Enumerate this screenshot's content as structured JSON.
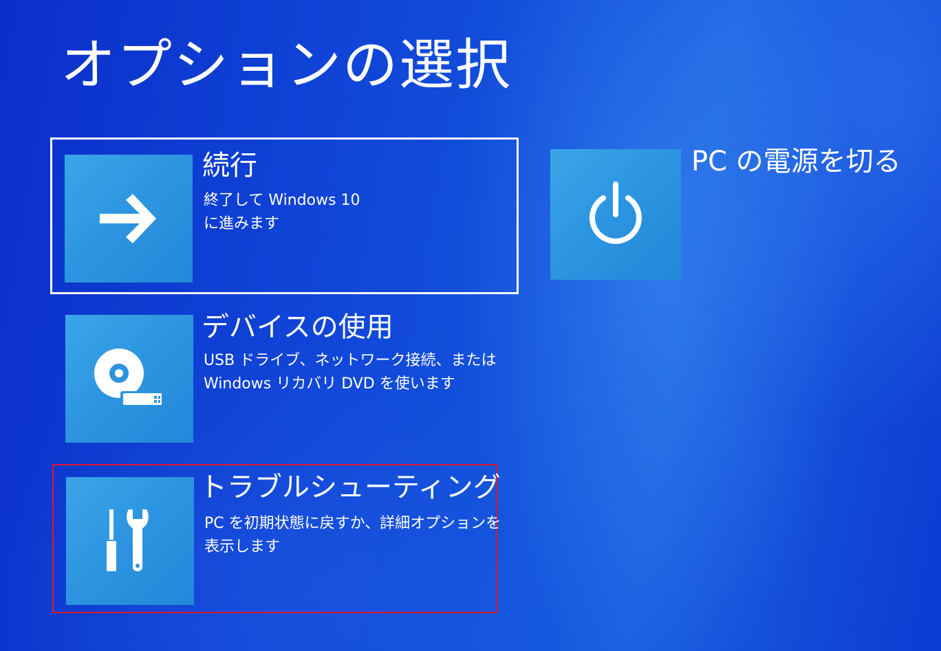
{
  "page_title": "オプションの選択",
  "options": {
    "continue": {
      "name": "続行",
      "desc_line1": "終了して Windows 10",
      "desc_line2": "に進みます",
      "icon": "arrow-right-icon"
    },
    "device": {
      "name": "デバイスの使用",
      "desc_line1": "USB ドライブ、ネットワーク接続、または",
      "desc_line2": "Windows リカバリ DVD を使います",
      "icon": "disc-usb-icon"
    },
    "troubleshoot": {
      "name": "トラブルシューティング",
      "desc_line1": "PC を初期状態に戻すか、詳細オプションを",
      "desc_line2": "表示します",
      "icon": "tools-icon"
    },
    "power": {
      "name": "PC の電源を切る",
      "icon": "power-icon"
    }
  },
  "colors": {
    "background": "#1248d8",
    "tile": "#2c94e0",
    "highlight_border": "#e0162b",
    "focus_border": "#ffffff"
  }
}
